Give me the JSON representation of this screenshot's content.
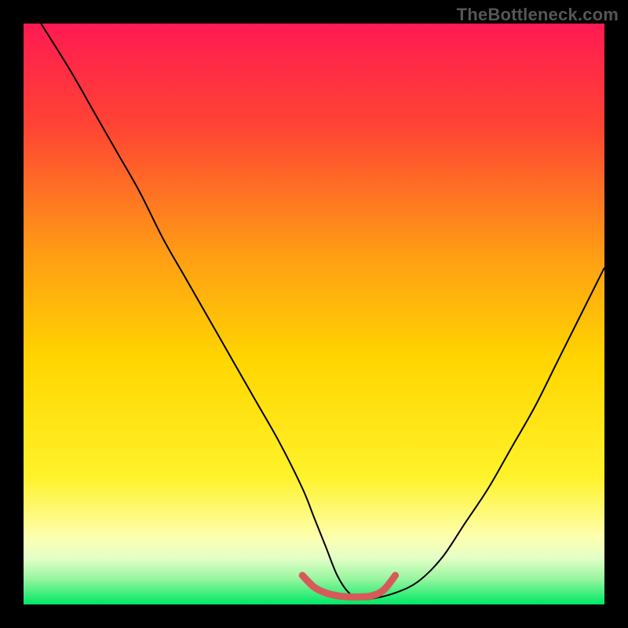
{
  "watermark": "TheBottleneck.com",
  "chart_data": {
    "type": "line",
    "title": "",
    "xlabel": "",
    "ylabel": "",
    "xlim": [
      0,
      100
    ],
    "ylim": [
      0,
      100
    ],
    "grid": false,
    "legend": false,
    "background_gradient": {
      "top_color": "#ff1a52",
      "mid_color": "#ffd600",
      "bottom_color": "#00e765",
      "stops": [
        {
          "offset": 0.0,
          "color": "#ff1a52"
        },
        {
          "offset": 0.18,
          "color": "#ff4533"
        },
        {
          "offset": 0.4,
          "color": "#ff9e14"
        },
        {
          "offset": 0.58,
          "color": "#ffd600"
        },
        {
          "offset": 0.78,
          "color": "#fff22a"
        },
        {
          "offset": 0.885,
          "color": "#fdffb0"
        },
        {
          "offset": 0.92,
          "color": "#e3ffc7"
        },
        {
          "offset": 0.955,
          "color": "#9af6a0"
        },
        {
          "offset": 1.0,
          "color": "#00e765"
        }
      ]
    },
    "series": [
      {
        "name": "bottleneck-curve",
        "color": "#000000",
        "stroke_width": 2,
        "x": [
          3,
          8,
          12,
          16,
          20,
          24,
          28,
          32,
          36,
          40,
          44,
          48,
          50,
          52,
          54,
          56,
          58,
          60,
          64,
          68,
          72,
          76,
          80,
          84,
          88,
          92,
          96,
          100
        ],
        "y": [
          100,
          92,
          85,
          78,
          71,
          63,
          56,
          49,
          42,
          35,
          28,
          20,
          15,
          10,
          5,
          2,
          1,
          1,
          2,
          4,
          8,
          14,
          20,
          27,
          34,
          42,
          50,
          58
        ]
      },
      {
        "name": "optimal-zone-marker",
        "color": "#d75a5a",
        "stroke_width": 9,
        "x": [
          48,
          50,
          52,
          54,
          56,
          58,
          60,
          62,
          64
        ],
        "y": [
          5,
          3,
          2,
          1.5,
          1.3,
          1.3,
          1.5,
          2.5,
          5
        ]
      }
    ]
  }
}
